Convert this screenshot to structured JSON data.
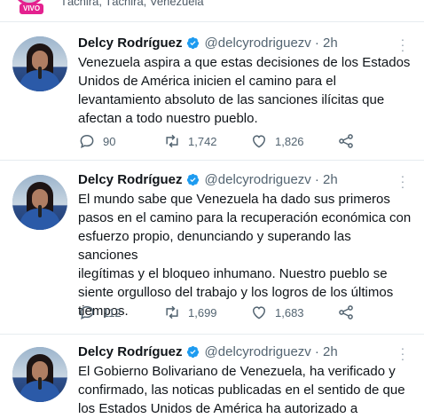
{
  "header": {
    "live_label": "VIVO",
    "location": "Táchira, Táchira, Venezuela"
  },
  "tweets": [
    {
      "name": "Delcy Rodríguez",
      "handle": "@delcyrodriguezv",
      "time": "· 2h",
      "lines": [
        "Venezuela aspira a que estas decisiones de los Estados",
        "Unidos de América inicien el camino para el",
        "levantamiento absoluto de las sanciones ilícitas que",
        "afectan a todo nuestro pueblo."
      ],
      "replies": "90",
      "retweets": "1,742",
      "likes": "1,826"
    },
    {
      "name": "Delcy Rodríguez",
      "handle": "@delcyrodriguezv",
      "time": "· 2h",
      "lines": [
        "El mundo sabe que Venezuela ha dado sus primeros",
        "pasos en el camino para la recuperación económica con",
        "esfuerzo propio, denunciando y superando las sanciones",
        "ilegítimas y el bloqueo inhumano. Nuestro pueblo se",
        "siente orgulloso del trabajo y los logros de los últimos",
        "tiempos."
      ],
      "replies": "112",
      "retweets": "1,699",
      "likes": "1,683"
    },
    {
      "name": "Delcy Rodríguez",
      "handle": "@delcyrodriguezv",
      "time": "· 2h",
      "lines": [
        "El Gobierno Bolivariano de Venezuela, ha verificado y",
        "confirmado, las noticas publicadas en el sentido de que",
        "los Estados Unidos de América ha autorizado a empresas"
      ]
    }
  ],
  "colors": {
    "accent": "#1d9bf0",
    "muted": "#536471",
    "live": "#e4218f"
  }
}
